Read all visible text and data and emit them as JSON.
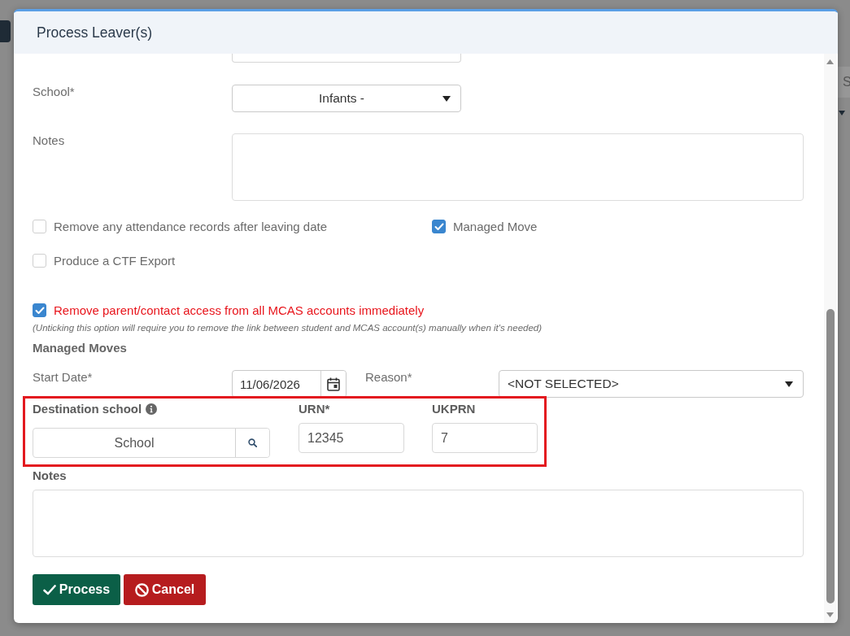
{
  "background": {
    "field_text": "S"
  },
  "dialog": {
    "title": "Process Leaver(s)",
    "fields": [
      {
        "kind": "select",
        "label": "School*",
        "value": "Infants -"
      },
      {
        "kind": "textarea",
        "label": "Notes"
      }
    ],
    "options": [
      {
        "label": "Remove any attendance records after leaving date",
        "checked": false
      },
      {
        "label": "Managed Move",
        "checked": true
      },
      {
        "label": "Produce a CTF Export",
        "checked": false
      }
    ],
    "mcas_option": {
      "label": "Remove parent/contact access from all MCAS accounts immediately",
      "checked": true,
      "note": "(Unticking this option will require you to remove the link between student and MCAS account(s) manually when it's needed)"
    },
    "managed_moves": {
      "heading": "Managed Moves",
      "start_date": {
        "label": "Start Date*",
        "value": "11/06/2026"
      },
      "reason": {
        "label": "Reason*",
        "value": "<NOT SELECTED>"
      },
      "destination_school": {
        "label": "Destination school",
        "value": "School"
      },
      "urn": {
        "label": "URN*",
        "value": "12345"
      },
      "ukprn": {
        "label": "UKPRN",
        "value": "7"
      },
      "notes": {
        "label": "Notes"
      }
    },
    "buttons": [
      {
        "kind": "process",
        "label": "Process"
      },
      {
        "kind": "cancel",
        "label": "Cancel"
      }
    ]
  }
}
